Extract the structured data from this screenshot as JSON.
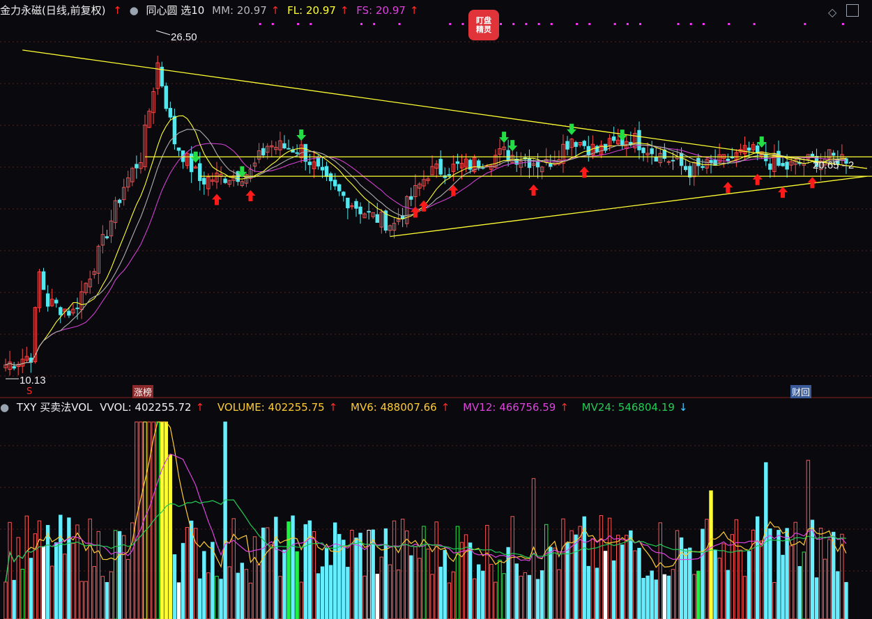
{
  "header_top": {
    "name": "金力永磁(日线,前复权)",
    "arrow": "↑",
    "indicator": "同心圆 选10",
    "mm_label": "MM: 20.97",
    "fl_label": "FL: 20.97",
    "fs_label": "FS: 20.97",
    "colors": {
      "name": "#f0f0f0",
      "mm": "#b8b8b8",
      "fl": "#ffff33",
      "fs": "#e040e0"
    }
  },
  "header_bottom": {
    "label": "TXY 买卖法VOL",
    "vvol": "VVOL: 402255.72",
    "volume": "VOLUME: 402255.75",
    "mv6": "MV6: 488007.66",
    "mv12": "MV12: 466756.59",
    "mv24": "MV24: 546804.19",
    "colors": {
      "vvol": "#f0f0f0",
      "volume": "#ffcc33",
      "mv6": "#ffcc33",
      "mv12": "#dd44dd",
      "mv24": "#22cc55"
    }
  },
  "badge": {
    "line1": "盯盘",
    "line2": "精灵"
  },
  "tags": {
    "s_marker": "S",
    "zhangbang": "涨榜",
    "caihui": "财回"
  },
  "annotations": {
    "high": "26.50",
    "low": "10.13",
    "last_range": "20.65 - 2"
  },
  "chart_data": [
    {
      "type": "candlestick",
      "ylim": [
        9,
        28
      ],
      "price_levels": {
        "upper": 21.0,
        "lower": 20.0
      },
      "trendlines": [
        {
          "name": "resistance",
          "from": [
            4,
            26.5
          ],
          "to": [
            199,
            20.4
          ]
        },
        {
          "name": "support",
          "from": [
            91,
            16.9
          ],
          "to": [
            199,
            20.0
          ]
        }
      ],
      "grid": true,
      "legend": "none"
    },
    {
      "type": "bar",
      "series": [
        {
          "name": "VOLUME"
        },
        {
          "name": "MV6"
        },
        {
          "name": "MV12"
        },
        {
          "name": "MV24"
        }
      ],
      "grid": true
    }
  ]
}
